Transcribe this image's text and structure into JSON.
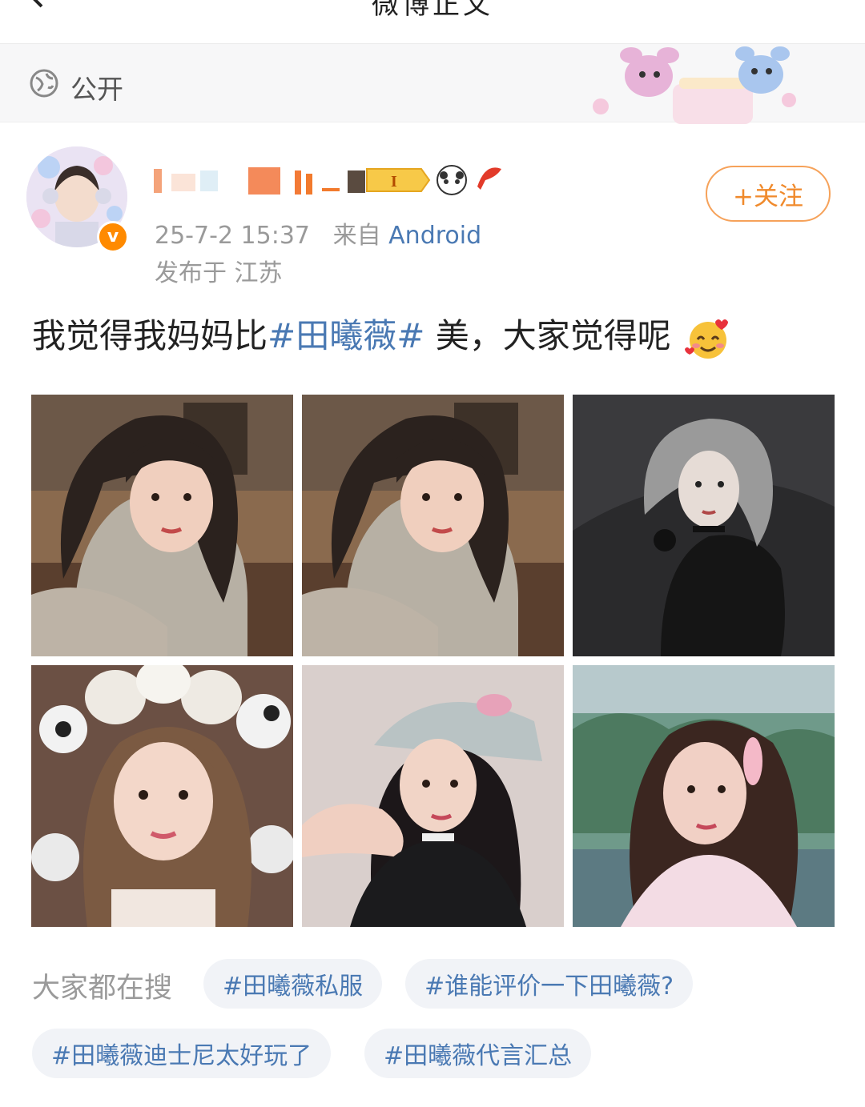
{
  "header": {
    "title": "微博正文"
  },
  "visibility": {
    "label": "公开"
  },
  "post": {
    "username": "",
    "time": "25-7-2 15:37",
    "source_prefix": "来自",
    "source": "Android",
    "location": "发布于 江苏",
    "follow_label": "+关注",
    "text_before": "我觉得我妈妈比",
    "hashtag": "#田曦薇#",
    "text_after": " 美，大家觉得呢",
    "emoji": "smiling-face-with-hearts",
    "photos": [
      {
        "name": "photo-1",
        "desc": "long dark hair, head resting on arm"
      },
      {
        "name": "photo-2",
        "desc": "long dark hair, head resting on arm"
      },
      {
        "name": "photo-3",
        "desc": "grey hair, black outfit on leather sofa"
      },
      {
        "name": "photo-4",
        "desc": "panda ear headband, light hair"
      },
      {
        "name": "photo-5",
        "desc": "grey cap, black cardigan"
      },
      {
        "name": "photo-6",
        "desc": "braided hair, pink hairclip, outdoors"
      }
    ]
  },
  "hot_search": {
    "label": "大家都在搜",
    "chips": [
      "#田曦薇私服",
      "#谁能评价一下田曦薇?",
      "#田曦薇迪士尼太好玩了",
      "#田曦薇代言汇总"
    ]
  },
  "colors": {
    "link": "#4a79b3",
    "follow": "#f08a2c",
    "muted": "#9a9a9a",
    "chip_bg": "#f1f3f7"
  }
}
